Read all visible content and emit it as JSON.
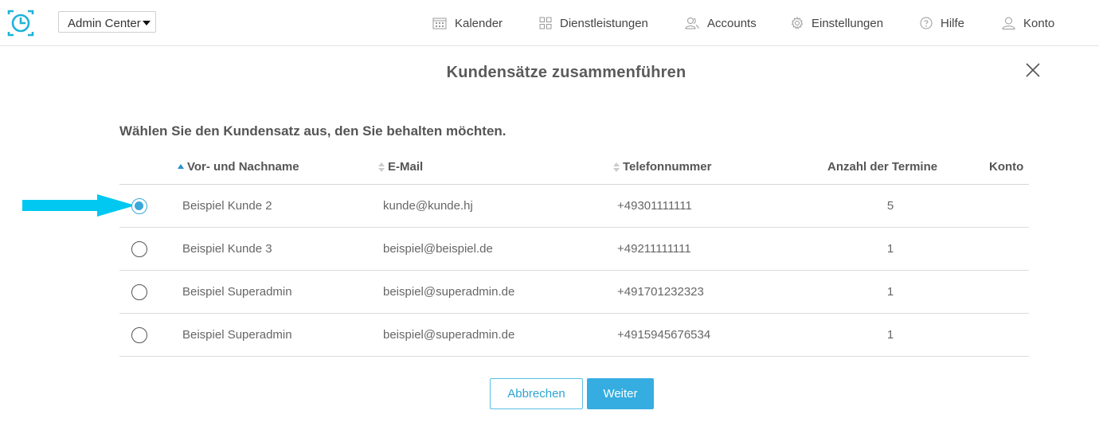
{
  "header": {
    "admin_select": "Admin Center",
    "nav": {
      "kalender": "Kalender",
      "dienstleistungen": "Dienstleistungen",
      "accounts": "Accounts",
      "einstellungen": "Einstellungen",
      "hilfe": "Hilfe",
      "konto": "Konto"
    }
  },
  "dialog": {
    "title": "Kundensätze zusammenführen",
    "subtitle": "Wählen Sie den Kundensatz aus, den Sie behalten möchten.",
    "columns": {
      "name": "Vor- und Nachname",
      "email": "E-Mail",
      "phone": "Telefonnummer",
      "count": "Anzahl der Termine",
      "konto": "Konto"
    },
    "rows": [
      {
        "name": "Beispiel Kunde 2",
        "email": "kunde@kunde.hj",
        "phone": "+49301111111",
        "count": "5",
        "selected": true
      },
      {
        "name": "Beispiel Kunde 3",
        "email": "beispiel@beispiel.de",
        "phone": "+49211111111",
        "count": "1",
        "selected": false
      },
      {
        "name": "Beispiel Superadmin",
        "email": "beispiel@superadmin.de",
        "phone": "+491701232323",
        "count": "1",
        "selected": false
      },
      {
        "name": "Beispiel Superadmin",
        "email": "beispiel@superadmin.de",
        "phone": "+4915945676534",
        "count": "1",
        "selected": false
      }
    ],
    "buttons": {
      "cancel": "Abbrechen",
      "next": "Weiter"
    }
  },
  "colors": {
    "accent": "#35ade0",
    "arrow": "#00c8f0",
    "logo": "#1fb3d8"
  },
  "icons": [
    "clock-logo-icon",
    "calendar-icon",
    "grid-icon",
    "users-icon",
    "gear-icon",
    "help-icon",
    "user-icon",
    "close-icon",
    "sort-icon"
  ]
}
